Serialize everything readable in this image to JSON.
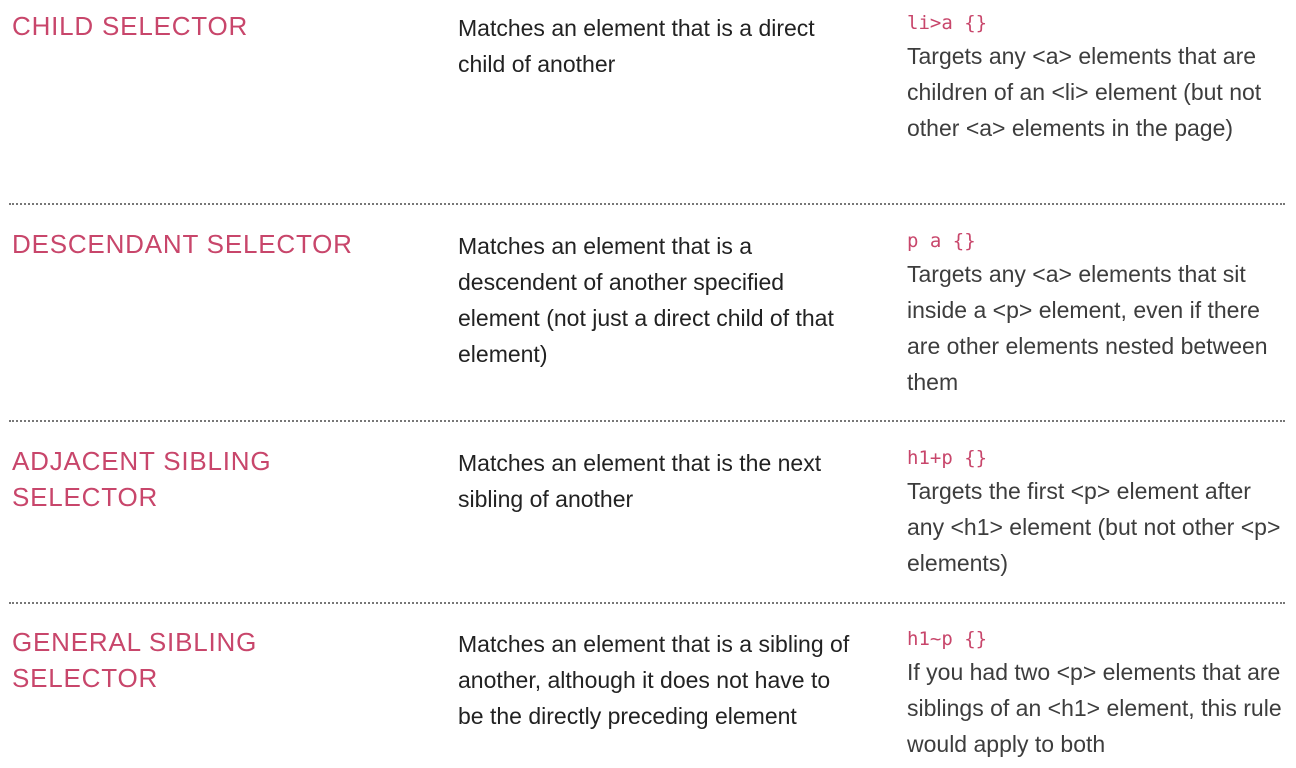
{
  "rows": [
    {
      "name": "CHILD SELECTOR",
      "description": "Matches an element that is a direct child of another",
      "code": "li>a {}",
      "example": "Targets any <a> elements that are children of an <li> element (but not other <a> elements in the page)"
    },
    {
      "name": "DESCENDANT SELECTOR",
      "description": "Matches an element that is a descendent of another specified element (not just a direct child of that element)",
      "code": "p a {}",
      "example": "Targets any <a> elements that sit inside a <p> element, even if there are other elements nested between them"
    },
    {
      "name": "ADJACENT SIBLING SELECTOR",
      "description": "Matches an element that is the next sibling of another",
      "code": "h1+p {}",
      "example": "Targets the first <p> element after any <h1> element (but not other <p> elements)"
    },
    {
      "name": "GENERAL SIBLING SELECTOR",
      "description": "Matches an element that is a sibling of another, although it does not have to be the directly preceding element",
      "code": "h1~p {}",
      "example": "If you had two <p> elements that are siblings of an <h1> element, this rule would apply to both"
    }
  ],
  "colors": {
    "accent": "#c8466b",
    "text": "#222222",
    "divider": "#777777"
  }
}
